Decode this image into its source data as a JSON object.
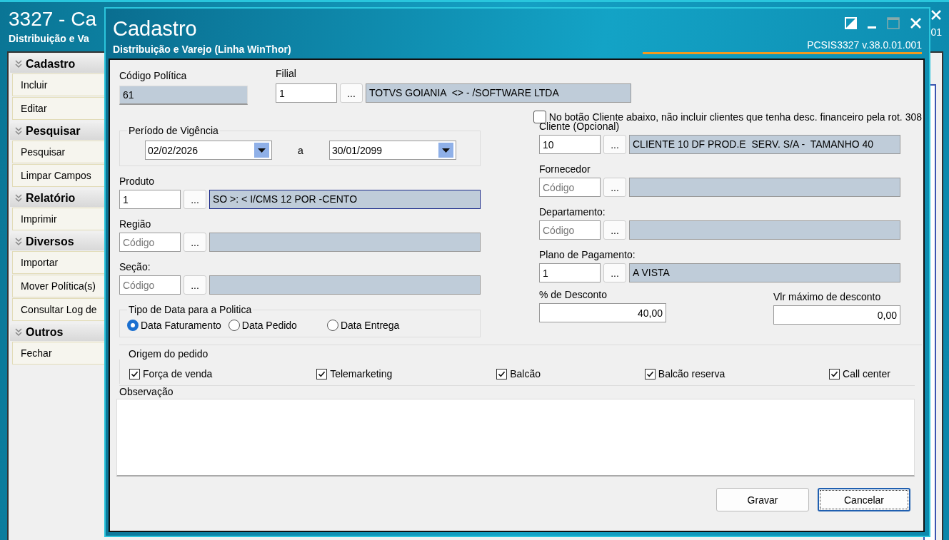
{
  "app_window": {
    "title": "3327 - Ca",
    "subtitle": "Distribuição e Va",
    "version": "01"
  },
  "sidebar": [
    {
      "title": "Cadastro",
      "items": [
        "Incluir",
        "Editar"
      ]
    },
    {
      "title": "Pesquisar",
      "items": [
        "Pesquisar",
        "Limpar Campos"
      ]
    },
    {
      "title": "Relatório",
      "items": [
        "Imprimir"
      ]
    },
    {
      "title": "Diversos",
      "items": [
        "Importar",
        "Mover Política(s)",
        "Consultar Log de"
      ]
    },
    {
      "title": "Outros",
      "items": [
        "Fechar"
      ]
    }
  ],
  "dialog": {
    "title": "Cadastro",
    "subtitle": "Distribuição e Varejo (Linha WinThor)",
    "version": "PCSIS3327  v.38.0.01.001"
  },
  "codigo_politica": {
    "label": "Código Política",
    "value": "61"
  },
  "filial": {
    "label": "Filial",
    "code": "1",
    "button": "...",
    "description": "TOTVS GOIANIA  <> - /SOFTWARE LTDA"
  },
  "option": {
    "label": "No botão Cliente abaixo, não incluir clientes que tenha desc. financeiro pela rot. 308",
    "checked": false
  },
  "left_column": [
    {
      "kind": "date_range",
      "label": "Período de Vigência",
      "start": "02/02/2026",
      "separator": "a",
      "end": "30/01/2099"
    },
    {
      "kind": "lookup",
      "label": "Produto",
      "code": "1",
      "button": "...",
      "description": "SO >: < I/CMS 12 POR -CENTO",
      "focused": true
    },
    {
      "kind": "lookup",
      "label": "Região",
      "placeholder": "Código",
      "button": "...",
      "focused": false
    },
    {
      "kind": "lookup",
      "label": "Seção:",
      "placeholder": "Código",
      "button": "...",
      "focused": false
    },
    {
      "kind": "radio_group",
      "label": "Tipo de Data para a Politica",
      "options": [
        {
          "label": "Data Faturamento",
          "selected": true
        },
        {
          "label": "Data Pedido",
          "selected": false
        },
        {
          "label": "Data Entrega",
          "selected": false
        }
      ]
    }
  ],
  "right_column": [
    {
      "kind": "lookup",
      "label": "Cliente (Opcional)",
      "code": "10",
      "button": "...",
      "description": "CLIENTE 10 DF PROD.E  SERV. S/A -  TAMANHO 40",
      "focused": false
    },
    {
      "kind": "lookup",
      "label": "Fornecedor",
      "placeholder": "Código",
      "button": "...",
      "focused": false
    },
    {
      "kind": "lookup",
      "label": "Departamento:",
      "placeholder": "Código",
      "button": "...",
      "focused": false
    },
    {
      "kind": "lookup",
      "label": "Plano de Pagamento:",
      "code": "1",
      "button": "...",
      "description": "A VISTA",
      "focused": false
    },
    {
      "kind": "amounts",
      "fields": [
        {
          "label": "% de Desconto",
          "value": "40,00"
        },
        {
          "label": "Vlr máximo de desconto",
          "value": "0,00"
        }
      ]
    }
  ],
  "origem_do_pedido": {
    "label": "Origem do pedido",
    "options": [
      {
        "label": "Força de venda",
        "checked": true
      },
      {
        "label": "Telemarketing",
        "checked": true
      },
      {
        "label": "Balcão",
        "checked": true
      },
      {
        "label": "Balcão reserva",
        "checked": true
      },
      {
        "label": "Call center",
        "checked": true
      }
    ]
  },
  "observacao": {
    "label": "Observação"
  },
  "buttons": [
    {
      "label": "Gravar",
      "focused": false
    },
    {
      "label": "Cancelar",
      "focused": true
    }
  ]
}
